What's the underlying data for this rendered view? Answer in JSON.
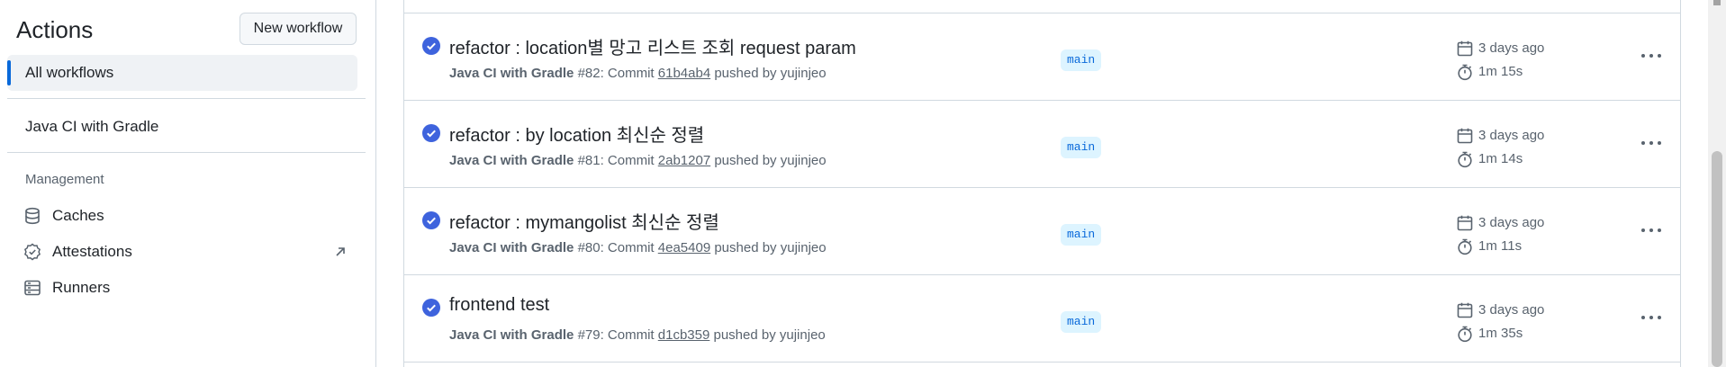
{
  "sidebar": {
    "title": "Actions",
    "new_workflow": "New workflow",
    "all_workflows": "All workflows",
    "workflow_link": "Java CI with Gradle",
    "management_title": "Management",
    "items": [
      {
        "label": "Caches",
        "icon": "database-icon"
      },
      {
        "label": "Attestations",
        "icon": "verified-icon"
      },
      {
        "label": "Runners",
        "icon": "server-icon"
      }
    ]
  },
  "runs": [
    {
      "title": "refactor : location별 망고 리스트 조회 request param",
      "workflow": "Java CI with Gradle",
      "number": "#82",
      "commit_prefix": ": Commit ",
      "sha": "61b4ab4",
      "pushed_by": " pushed by yujinjeo",
      "branch": "main",
      "when": "3 days ago",
      "duration": "1m 15s"
    },
    {
      "title": "refactor : by location 최신순 정렬",
      "workflow": "Java CI with Gradle",
      "number": "#81",
      "commit_prefix": ": Commit ",
      "sha": "2ab1207",
      "pushed_by": " pushed by yujinjeo",
      "branch": "main",
      "when": "3 days ago",
      "duration": "1m 14s"
    },
    {
      "title": "refactor : mymangolist 최신순 정렬",
      "workflow": "Java CI with Gradle",
      "number": "#80",
      "commit_prefix": ": Commit ",
      "sha": "4ea5409",
      "pushed_by": " pushed by yujinjeo",
      "branch": "main",
      "when": "3 days ago",
      "duration": "1m 11s"
    },
    {
      "title": "frontend test",
      "workflow": "Java CI with Gradle",
      "number": "#79",
      "commit_prefix": ": Commit ",
      "sha": "d1cb359",
      "pushed_by": " pushed by yujinjeo",
      "branch": "main",
      "when": "3 days ago",
      "duration": "1m 35s"
    }
  ],
  "colors": {
    "accent": "#0969da",
    "success": "#0969da",
    "muted": "#59636e",
    "border": "#d1d9e0"
  }
}
